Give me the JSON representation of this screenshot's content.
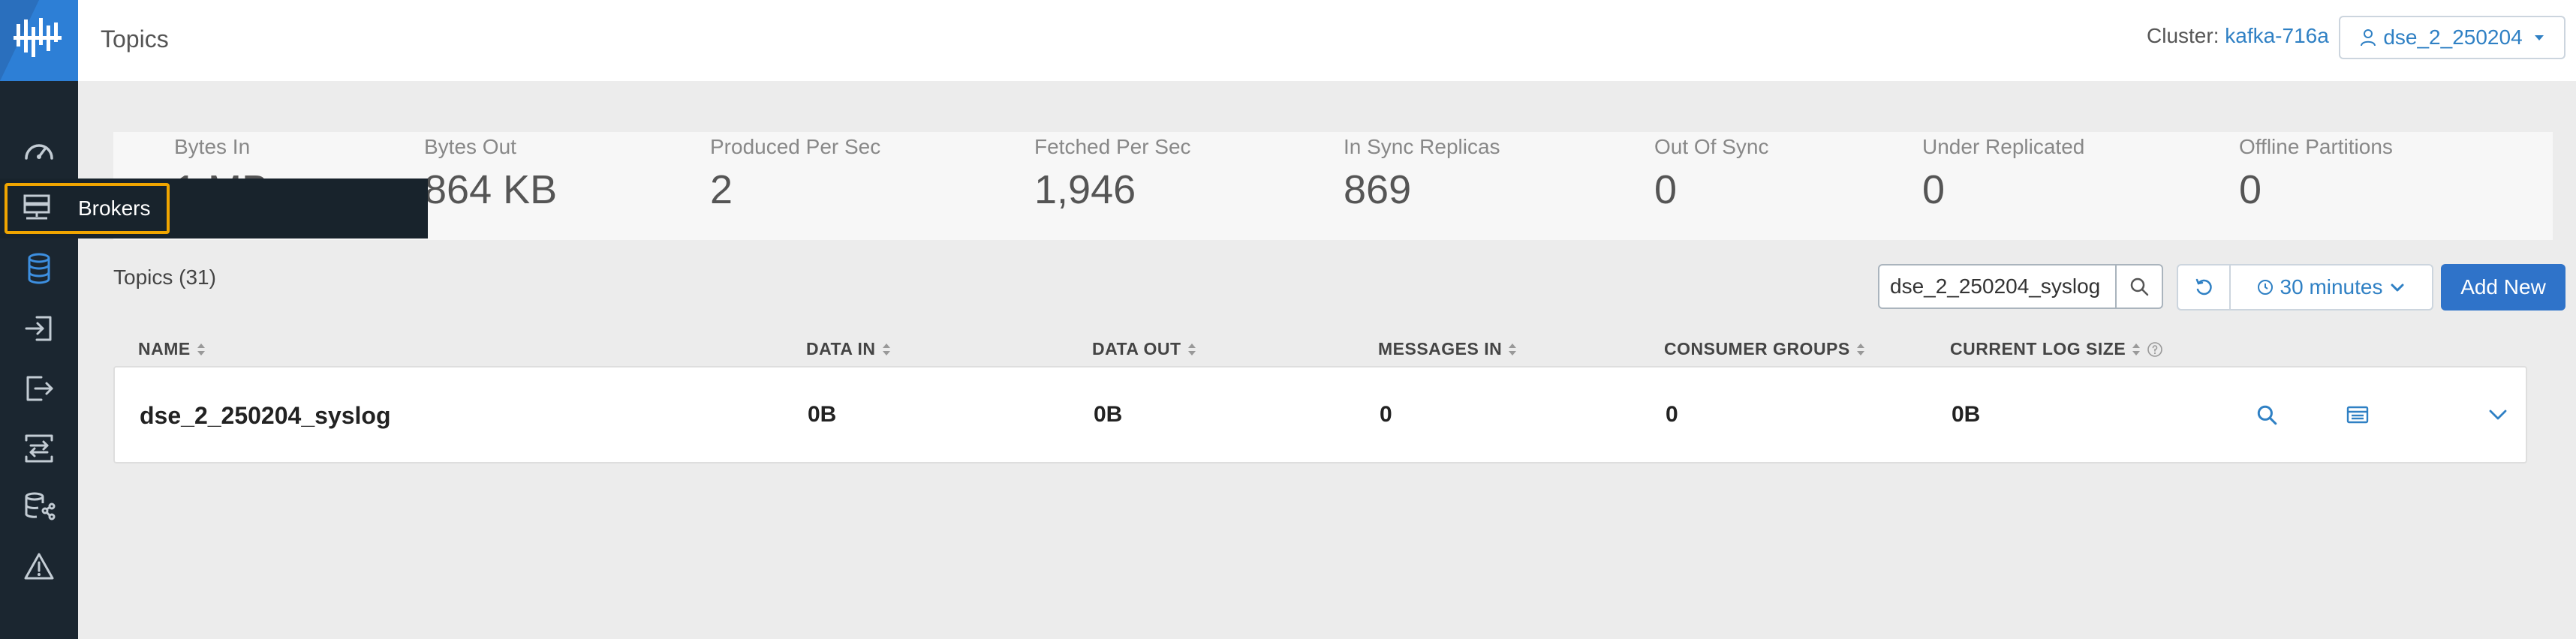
{
  "header": {
    "title": "Topics",
    "cluster_label": "Cluster:",
    "cluster_name": "kafka-716a",
    "user": "dse_2_250204"
  },
  "sidebar": {
    "items": [
      {
        "icon": "dashboard-gauge-icon"
      },
      {
        "icon": "brokers-icon",
        "tooltip": "Brokers"
      },
      {
        "icon": "topics-database-icon",
        "active": true
      },
      {
        "icon": "producers-icon"
      },
      {
        "icon": "consumers-icon"
      },
      {
        "icon": "replication-icon"
      },
      {
        "icon": "schema-registry-icon"
      },
      {
        "icon": "alerts-warning-icon"
      }
    ]
  },
  "metrics": [
    {
      "label": "Bytes In",
      "value": "1 MB"
    },
    {
      "label": "Bytes Out",
      "value": "864 KB"
    },
    {
      "label": "Produced Per Sec",
      "value": "2"
    },
    {
      "label": "Fetched Per Sec",
      "value": "1,946"
    },
    {
      "label": "In Sync Replicas",
      "value": "869"
    },
    {
      "label": "Out Of Sync",
      "value": "0"
    },
    {
      "label": "Under Replicated",
      "value": "0"
    },
    {
      "label": "Offline Partitions",
      "value": "0"
    }
  ],
  "topics": {
    "count_label": "Topics (31)",
    "search_value": "dse_2_250204_syslog",
    "time_range": "30 minutes",
    "add_label": "Add New",
    "columns": [
      "NAME",
      "DATA IN",
      "DATA OUT",
      "MESSAGES IN",
      "CONSUMER GROUPS",
      "CURRENT LOG SIZE"
    ],
    "rows": [
      {
        "name": "dse_2_250204_syslog",
        "data_in": "0B",
        "data_out": "0B",
        "messages_in": "0",
        "consumer_groups": "0",
        "log_size": "0B"
      }
    ]
  },
  "colors": {
    "accent": "#2f80c4",
    "sidebar": "#1b2630",
    "primary_button": "#2f73c9",
    "highlight": "#f0a500"
  }
}
